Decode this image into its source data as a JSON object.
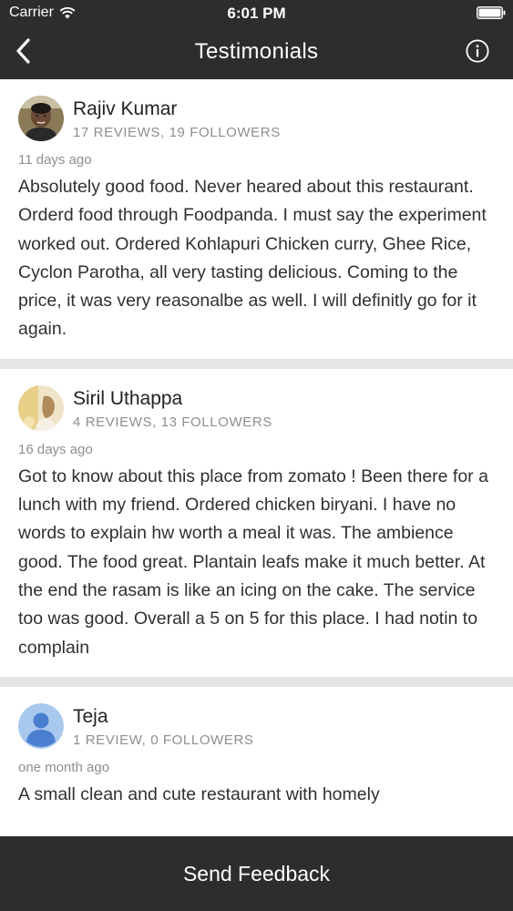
{
  "status_bar": {
    "carrier": "Carrier",
    "time": "6:01 PM"
  },
  "nav": {
    "title": "Testimonials",
    "back_icon": "chevron-left-icon",
    "info_icon": "info-circle-icon"
  },
  "reviews": [
    {
      "name": "Rajiv Kumar",
      "meta": "17 REVIEWS, 19 FOLLOWERS",
      "time": "11 days ago",
      "text": "Absolutely good food. Never heared about this restaurant. Orderd food through Foodpanda. I must say the experiment worked out. Ordered Kohlapuri Chicken curry, Ghee Rice, Cyclon Parotha, all very tasting delicious. Coming to the price, it was very reasonalbe as well. I will definitly go for it again."
    },
    {
      "name": "Siril Uthappa",
      "meta": "4 REVIEWS, 13 FOLLOWERS",
      "time": "16 days ago",
      "text": "Got to know about this place from zomato ! Been there for a lunch with my friend. Ordered chicken biryani. I have no words to explain hw worth a meal it was. The ambience good. The food great. Plantain leafs make it much better. At the end the rasam is like an icing on the  cake. The service too was good. Overall a 5 on 5 for  this place. I had notin to complain"
    },
    {
      "name": "Teja",
      "meta": "1 REVIEW, 0 FOLLOWERS",
      "time": "one month ago",
      "text": "A small clean and cute restaurant with homely"
    }
  ],
  "footer": {
    "button_label": "Send Feedback"
  },
  "colors": {
    "bar_bg": "#2d2d2d",
    "separator": "#e6e6e6",
    "meta_text": "#8e8e8e",
    "default_avatar": "#a8c8ee"
  }
}
